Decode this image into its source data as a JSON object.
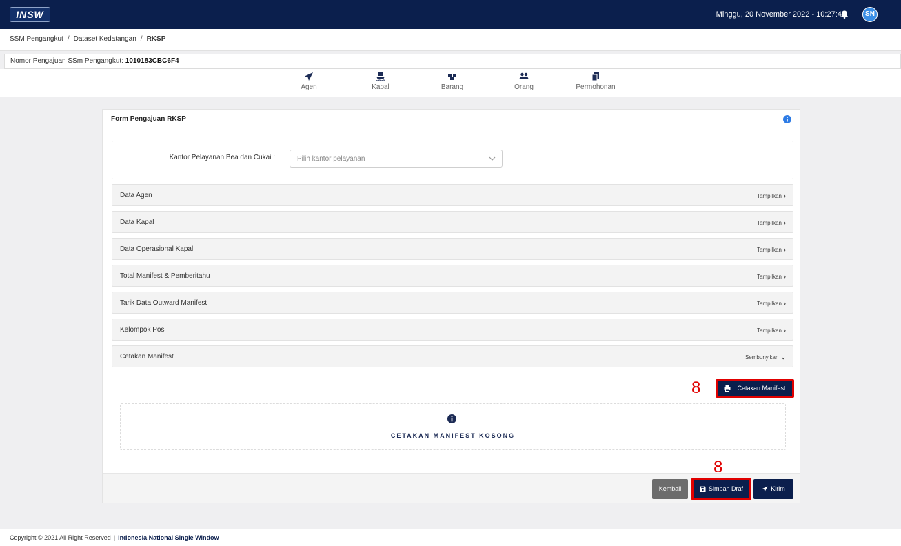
{
  "header": {
    "logo_text": "INSW",
    "datetime": "Minggu, 20 November 2022 - 10:27:45",
    "avatar_initials": "SN"
  },
  "breadcrumb": {
    "items": [
      "SSM Pengangkut",
      "Dataset Kedatangan"
    ],
    "current": "RKSP",
    "separator": "/"
  },
  "nomor": {
    "label": "Nomor Pengajuan SSm Pengangkut:",
    "value": "1010183CBC6F4"
  },
  "steps": [
    {
      "label": "Agen",
      "icon": "paper-plane-icon"
    },
    {
      "label": "Kapal",
      "icon": "ship-icon"
    },
    {
      "label": "Barang",
      "icon": "boxes-icon"
    },
    {
      "label": "Orang",
      "icon": "users-icon"
    },
    {
      "label": "Permohonan",
      "icon": "documents-icon"
    }
  ],
  "form": {
    "title": "Form Pengajuan RKSP",
    "kantor_label": "Kantor Pelayanan Bea dan Cukai :",
    "kantor_placeholder": "Pilih kantor pelayanan",
    "sections": [
      {
        "title": "Data Agen",
        "action": "Tampilkan"
      },
      {
        "title": "Data Kapal",
        "action": "Tampilkan"
      },
      {
        "title": "Data Operasional Kapal",
        "action": "Tampilkan"
      },
      {
        "title": "Total Manifest & Pemberitahu",
        "action": "Tampilkan"
      },
      {
        "title": "Tarik Data Outward Manifest",
        "action": "Tampilkan"
      },
      {
        "title": "Kelompok Pos",
        "action": "Tampilkan"
      },
      {
        "title": "Cetakan Manifest",
        "action": "Sembunyikan"
      }
    ],
    "cetak_button": "Cetakan Manifest",
    "empty_text": "CETAKAN MANIFEST KOSONG",
    "annotation_marker": "8"
  },
  "footer_buttons": {
    "kembali": "Kembali",
    "simpan": "Simpan Draf",
    "kirim": "Kirim"
  },
  "footer": {
    "copyright": "Copyright © 2021 All Right Reserved",
    "separator": "|",
    "org": "Indonesia National Single Window"
  },
  "colors": {
    "navy": "#0b1f4d",
    "annotation_red": "#e00000",
    "info_blue": "#2d7be5"
  }
}
